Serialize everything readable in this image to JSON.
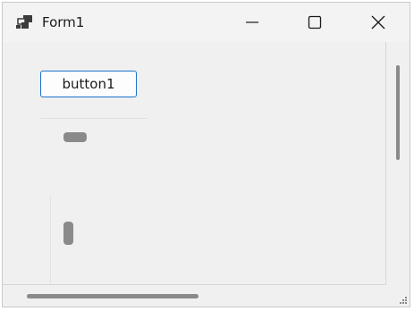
{
  "window": {
    "title": "Form1",
    "icons": {
      "app": "app-window-icon",
      "minimize": "minimize-icon",
      "maximize": "maximize-icon",
      "close": "close-icon",
      "grip": "resize-grip-icon"
    }
  },
  "form": {
    "button1_label": "button1"
  },
  "colors": {
    "button_border": "#1a73c9",
    "scroll_thumb": "#8a8a8a",
    "client_background": "#f0f0f0"
  }
}
